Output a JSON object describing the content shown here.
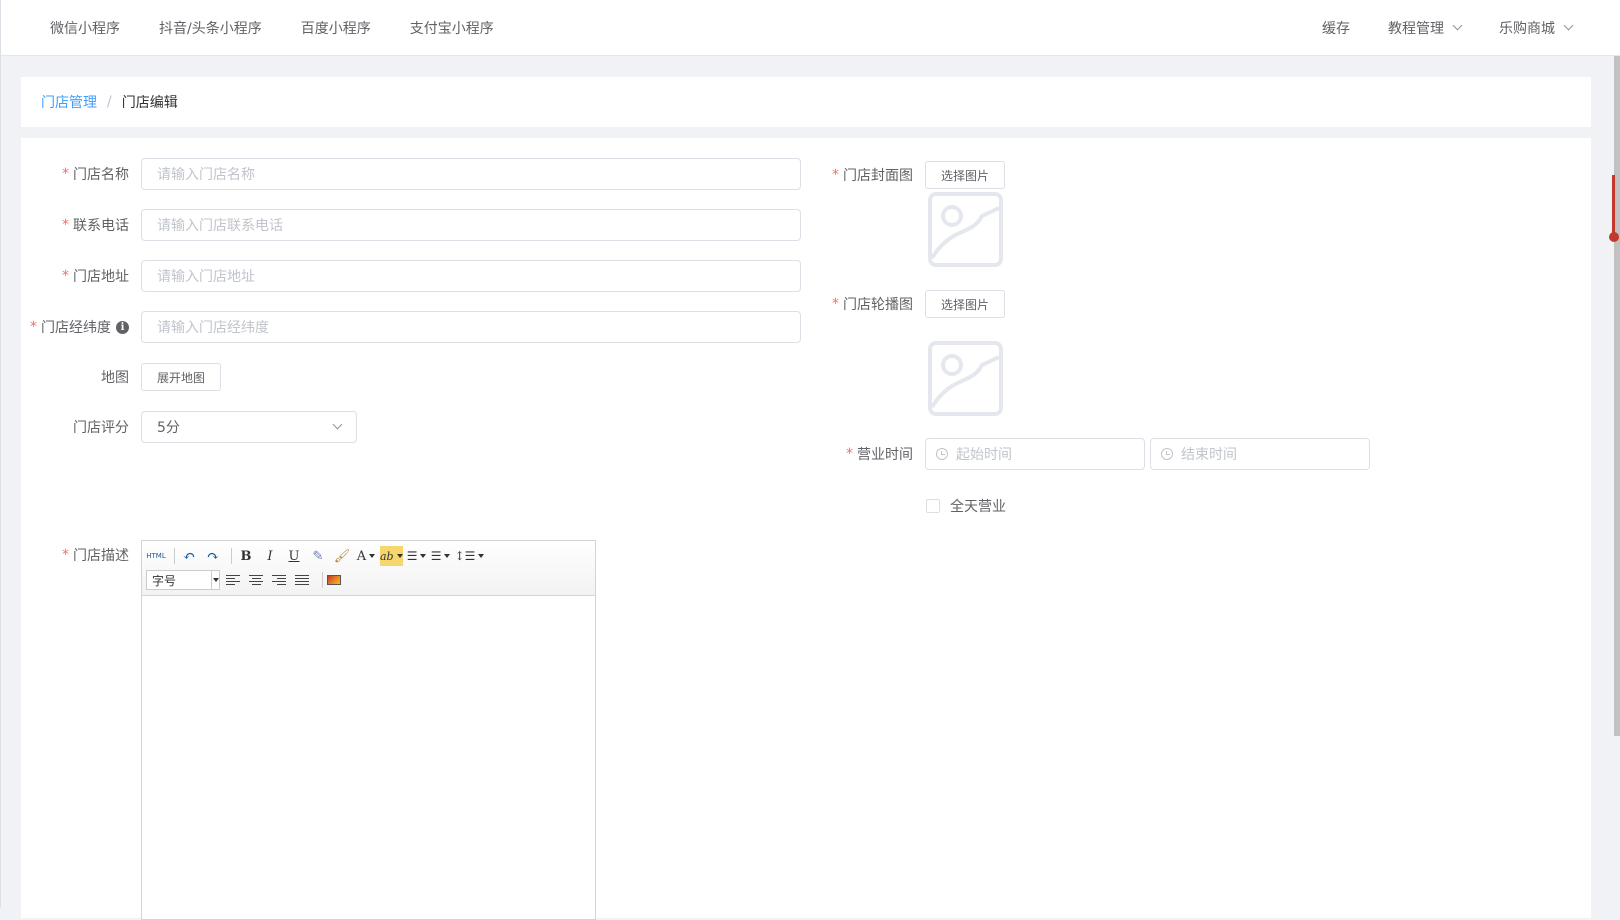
{
  "topnav": {
    "left": [
      "微信小程序",
      "抖音/头条小程序",
      "百度小程序",
      "支付宝小程序"
    ],
    "right": {
      "cache": "缓存",
      "tutorial": "教程管理",
      "shop": "乐购商城"
    }
  },
  "breadcrumb": {
    "parent": "门店管理",
    "separator": "/",
    "current": "门店编辑"
  },
  "form": {
    "name": {
      "label": "门店名称",
      "placeholder": "请输入门店名称"
    },
    "phone": {
      "label": "联系电话",
      "placeholder": "请输入门店联系电话"
    },
    "address": {
      "label": "门店地址",
      "placeholder": "请输入门店地址"
    },
    "latlng": {
      "label": "门店经纬度",
      "placeholder": "请输入门店经纬度",
      "info": "i"
    },
    "map": {
      "label": "地图",
      "button": "展开地图"
    },
    "rating": {
      "label": "门店评分",
      "value": "5分"
    },
    "cover": {
      "label": "门店封面图",
      "button": "选择图片"
    },
    "carousel": {
      "label": "门店轮播图",
      "button": "选择图片"
    },
    "hours": {
      "label": "营业时间",
      "start_placeholder": "起始时间",
      "end_placeholder": "结束时间"
    },
    "allday": {
      "label": "全天营业"
    },
    "description": {
      "label": "门店描述"
    },
    "required_mark": "*"
  },
  "editor": {
    "html_label": "HTML",
    "bold": "B",
    "italic": "I",
    "underline": "U",
    "font_color": "A",
    "highlight": "ab",
    "fontsize": "字号"
  }
}
